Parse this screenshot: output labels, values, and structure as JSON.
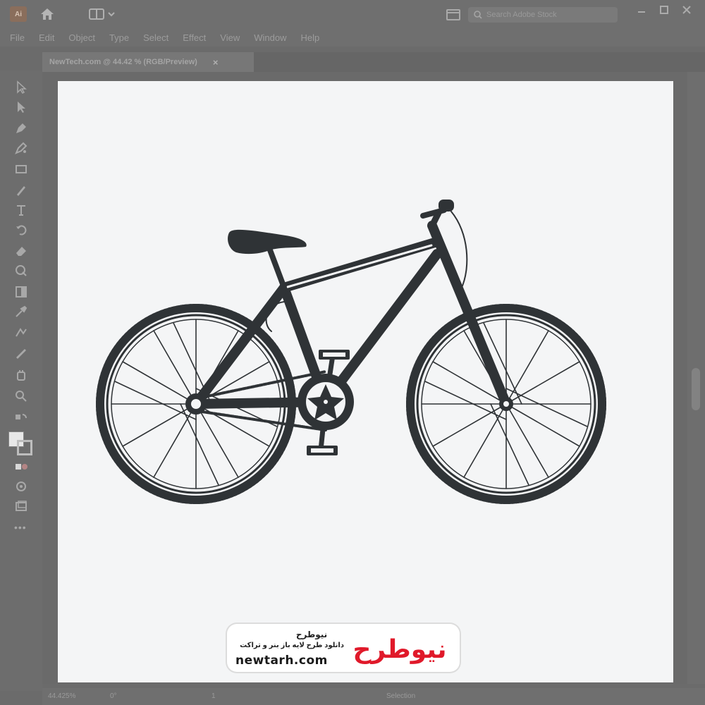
{
  "app": {
    "logo_text": "Ai",
    "search_placeholder": "Search Adobe Stock"
  },
  "menu": [
    "File",
    "Edit",
    "Object",
    "Type",
    "Select",
    "Effect",
    "View",
    "Window",
    "Help"
  ],
  "document": {
    "tab_title": "NewTech.com @ 44.42 % (RGB/Preview)",
    "close_glyph": "×"
  },
  "statusbar": {
    "zoom": "44.425%",
    "rotation": "0°",
    "artboard_num": "1",
    "tool_name": "Selection"
  },
  "watermark": {
    "brand_fa": "نیوطرح",
    "tagline_fa": "دانلود طرح لایه باز بنر و تراکت",
    "url": "newtarh.com",
    "logo_text": "نیوطرح",
    "logo_color": "#e0192a"
  },
  "colors": {
    "bike": "#2f3336",
    "artboard": "#f4f5f6"
  }
}
